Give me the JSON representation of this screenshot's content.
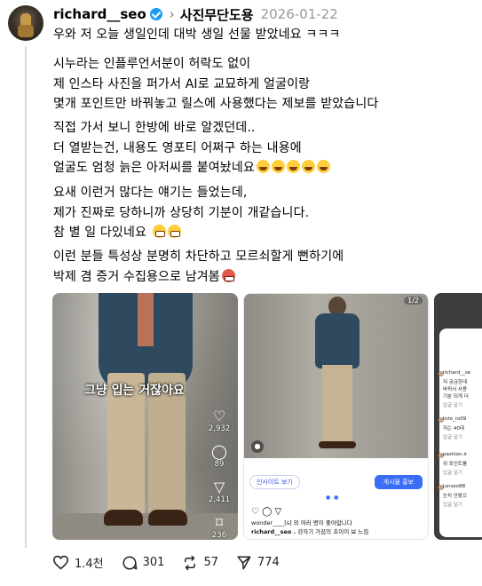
{
  "header": {
    "username": "richard__seo",
    "separator": "›",
    "topic": "사진무단도용",
    "date": "2026-01-22"
  },
  "post": {
    "line1": "우와 저 오늘 생일인데 대박 생일 선물 받았네요 ㅋㅋㅋ",
    "p2": [
      "시누라는 인플루언서분이 허락도 없이",
      "제 인스타 사진을 퍼가서 AI로 교묘하게 얼굴이랑",
      "몇개 포인트만 바꿔놓고 릴스에 사용했다는 제보를 받았습니다"
    ],
    "p3": [
      "직접 가서 보니 한방에 바로 알겠던데..",
      "더 열받는건, 내용도 영포티 어쩌구 하는 내용에",
      "얼굴도 엄청 늙은 아저씨를 붙여놨네요"
    ],
    "p4": [
      "요새 이런거 많다는 얘기는 들었는데,",
      "제가 진짜로 당하니까 상당히 기분이 개같습니다.",
      "참 별 일 다있네요"
    ],
    "p5": [
      "이런 분들 특성상 분명히 차단하고 모르쇠할게 뻔하기에",
      "박제 겸 증거 수집용으로 남겨봄"
    ]
  },
  "media1": {
    "caption": "그냥 입는 거잖아요",
    "counts": [
      "2,932",
      "89",
      "2,411",
      "236"
    ],
    "icons": [
      "heart-icon",
      "comment-icon",
      "share-icon",
      "bookmark-icon"
    ]
  },
  "media2": {
    "tag": "1/2",
    "insight_label": "인사이트 보기",
    "promote_label": "게시물 홍보",
    "likes_text": "wonder____[s] 외 여러 명이 좋아합니다",
    "caption_text": "richard__seo .",
    "caption_more": "걍자기 가끔의 초이이 보 느낌"
  },
  "media3": {
    "comments": [
      {
        "user": "richard__se",
        "text": "저 궁금한데",
        "text2": "바뀌서 사용",
        "text3": "기분 되게 더"
      },
      {
        "user": "toto_ro09",
        "text": "저는 40대"
      },
      {
        "user": "pashion.ir",
        "text": "위 포인트를"
      },
      {
        "user": "junseo88",
        "text": "눈치 안봤으"
      }
    ],
    "reply": "답글 달기"
  },
  "actions": {
    "likes": "1.4천",
    "comments": "301",
    "reposts": "57",
    "shares": "774"
  }
}
